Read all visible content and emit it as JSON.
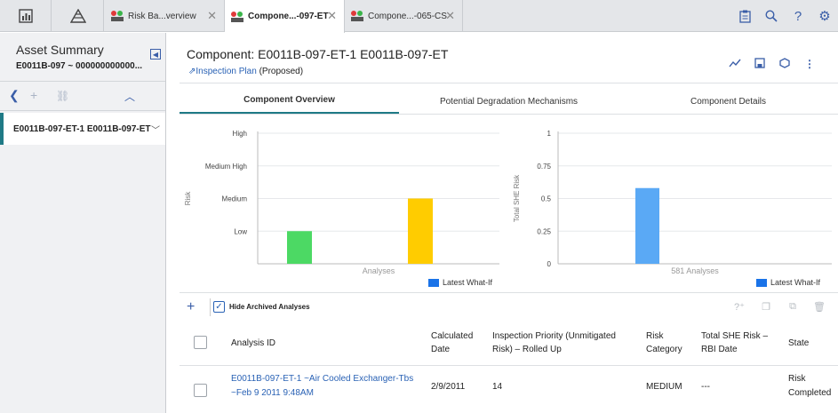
{
  "topbar": {
    "tabs": [
      {
        "label": "Risk Ba...verview"
      },
      {
        "label": "Compone...-097-ET"
      },
      {
        "label": "Compone...-065-CS"
      }
    ]
  },
  "left_panel": {
    "title": "Asset Summary",
    "subtitle": "E0011B-097 ~ 000000000000...",
    "tree_item": "E0011B-097-ET-1 E0011B-097-ET"
  },
  "header": {
    "title": "Component: E0011B-097-ET-1 E0011B-097-ET",
    "inspection_link": "Inspection Plan",
    "inspection_status": "(Proposed)"
  },
  "subtabs": [
    "Component Overview",
    "Potential Degradation Mechanisms",
    "Component Details"
  ],
  "chart_data": [
    {
      "type": "bar",
      "ylabel": "Risk",
      "xlabel": "Analyses",
      "yticks": [
        "Low",
        "Medium",
        "Medium High",
        "High"
      ],
      "bars": [
        {
          "value": 1,
          "color": "#4cd964"
        },
        {
          "value": 2,
          "color": "#ffcc00"
        }
      ],
      "legend": "Latest What-If",
      "legend_color": "#1a73e8"
    },
    {
      "type": "bar",
      "ylabel": "Total SHE Risk",
      "xlabel": "581 Analyses",
      "yticks": [
        "0",
        "0.25",
        "0.5",
        "0.75",
        "1"
      ],
      "ylim": [
        0,
        1
      ],
      "values": [
        0.58
      ],
      "bar_color": "#5aa9f5",
      "legend": "Latest What-If",
      "legend_color": "#1a73e8"
    }
  ],
  "grid": {
    "hide_archived_label": "Hide Archived Analyses",
    "columns": {
      "analysis_id": "Analysis ID",
      "calc_date_1": "Calculated",
      "calc_date_2": "Date",
      "priority_1": "Inspection Priority (Unmitigated",
      "priority_2": "Risk) – Rolled Up",
      "risk_cat_1": "Risk",
      "risk_cat_2": "Category",
      "she_1": "Total SHE Risk –",
      "she_2": "RBI Date",
      "state": "State"
    },
    "rows": [
      {
        "analysis_id_1": "E0011B-097-ET-1 ~Air Cooled Exchanger-Tbs",
        "analysis_id_2": "~Feb 9 2011 9:48AM",
        "calculated_date": "2/9/2011",
        "priority": "14",
        "risk_category": "MEDIUM",
        "she_risk": "---",
        "state_1": "Risk",
        "state_2": "Completed"
      }
    ]
  }
}
